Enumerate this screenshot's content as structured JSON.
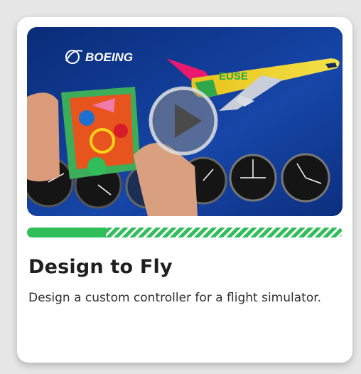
{
  "card": {
    "title": "Design to Fly",
    "description": "Design a custom controller for a flight simulator."
  },
  "video": {
    "logo_text": "BOEING",
    "tail_text": "EUSE",
    "play_icon": "play-icon"
  },
  "progress": {
    "completed": 0.25
  },
  "colors": {
    "accent_green": "#2fbe5a",
    "video_background": "#0e3a8a"
  }
}
